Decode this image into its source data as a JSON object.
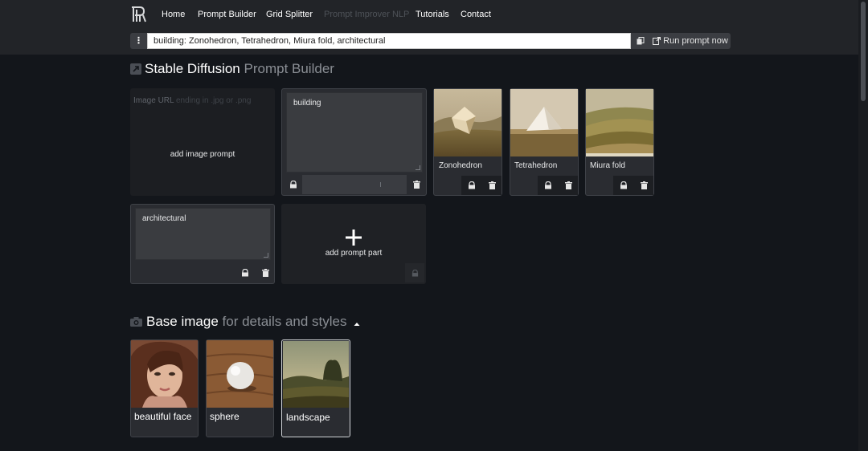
{
  "nav": {
    "items": [
      {
        "label": "Home",
        "disabled": false
      },
      {
        "label": "Prompt Builder",
        "disabled": false
      },
      {
        "label": "Grid Splitter",
        "disabled": false
      },
      {
        "label": "Prompt Improver NLP",
        "disabled": true
      },
      {
        "label": "Tutorials",
        "disabled": false
      },
      {
        "label": "Contact",
        "disabled": false
      }
    ]
  },
  "prompt_bar": {
    "menu_icon": "vertical-ellipsis-icon",
    "value": "building: Zonohedron, Tetrahedron, Miura fold, architectural",
    "copy_icon": "copy-icon",
    "run_label": "Run prompt now",
    "run_icon": "external-link-icon"
  },
  "builder": {
    "title_main": "Stable Diffusion",
    "title_sub": "Prompt Builder",
    "image_url_label": "Image URL",
    "image_url_placeholder": "ending in .jpg or .png",
    "add_image_prompt": "add image prompt",
    "part1": {
      "text": "building",
      "lock_icon": "lock-icon",
      "delete_icon": "trash-icon"
    },
    "styles": [
      {
        "label": "Zonohedron"
      },
      {
        "label": "Tetrahedron"
      },
      {
        "label": "Miura fold"
      }
    ],
    "part2": {
      "text": "architectural"
    },
    "add_part_label": "add prompt part",
    "add_part_icon": "plus-icon"
  },
  "base_image": {
    "title_main": "Base image",
    "title_sub": "for details and styles",
    "toggle_icon": "caret-up-icon",
    "items": [
      {
        "label": "beautiful face",
        "selected": false
      },
      {
        "label": "sphere",
        "selected": false
      },
      {
        "label": "landscape",
        "selected": true
      }
    ]
  },
  "colors": {
    "background": "#13161b",
    "topbar": "#222428",
    "card": "#2a2c31",
    "selected_border": "#cfd2d6"
  }
}
